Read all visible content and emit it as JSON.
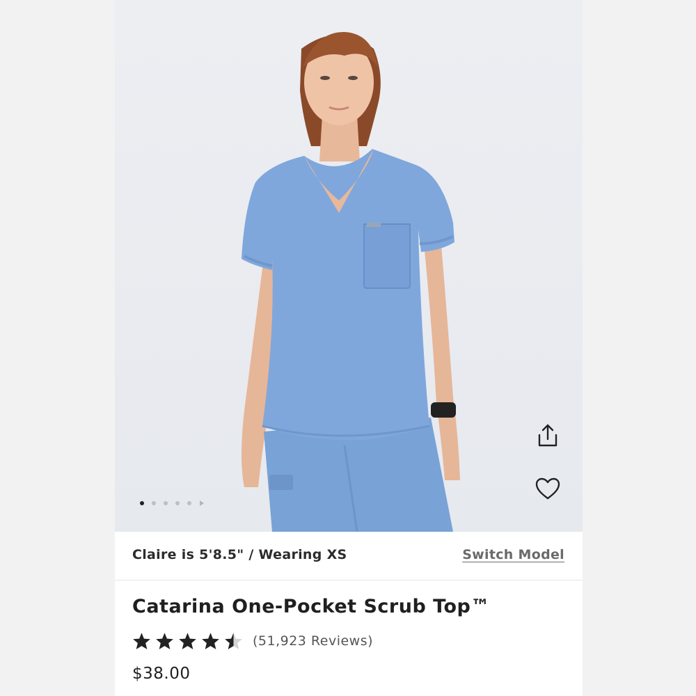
{
  "gallery": {
    "image_alt": "Model wearing ceil blue scrub top and pants",
    "dot_count": 5,
    "active_dot": 0
  },
  "actions": {
    "share_icon": "share-icon",
    "favorite_icon": "heart-icon"
  },
  "model_info": {
    "text": "Claire is 5'8.5\" / Wearing XS",
    "switch_label": "Switch Model"
  },
  "product": {
    "title": "Catarina One-Pocket Scrub Top™",
    "rating": 4.5,
    "reviews_label": "(51,923 Reviews)",
    "price": "$38.00"
  },
  "colors": {
    "scrub_blue": "#7fa7dc",
    "text_dark": "#1f1f1f"
  }
}
